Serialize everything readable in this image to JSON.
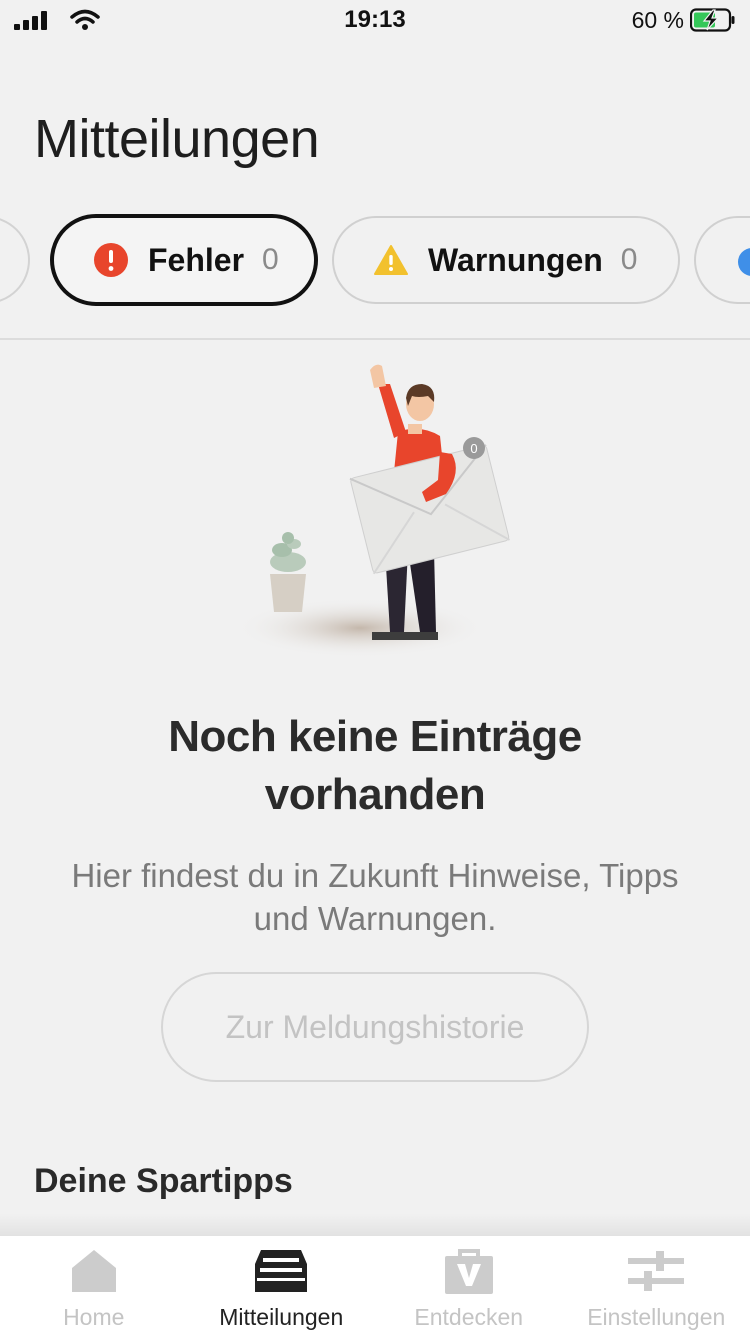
{
  "status_bar": {
    "time": "19:13",
    "battery_percent": "60 %"
  },
  "page": {
    "title": "Mitteilungen"
  },
  "filters": [
    {
      "label": "Fehler",
      "count": "0",
      "icon": "error-icon",
      "color": "#e8452c",
      "selected": true
    },
    {
      "label": "Warnungen",
      "count": "0",
      "icon": "warning-icon",
      "color": "#f2c12e",
      "selected": false
    },
    {
      "label": "",
      "count": "",
      "icon": "info-icon",
      "color": "#3f8fe8",
      "selected": false
    }
  ],
  "illustration": {
    "badge_count": "0"
  },
  "empty_state": {
    "title_line1": "Noch keine Einträge",
    "title_line2": "vorhanden",
    "text_line1": "Hier findest du in Zukunft Hinweise, Tipps",
    "text_line2": "und Warnungen.",
    "button_label": "Zur Meldungshistorie"
  },
  "sections": {
    "spartipps_title": "Deine Spartipps"
  },
  "tabbar": {
    "items": [
      {
        "label": "Home",
        "icon": "home-icon",
        "active": false
      },
      {
        "label": "Mitteilungen",
        "icon": "inbox-icon",
        "active": true
      },
      {
        "label": "Entdecken",
        "icon": "briefcase-icon",
        "active": false
      },
      {
        "label": "Einstellungen",
        "icon": "sliders-icon",
        "active": false
      }
    ]
  },
  "colors": {
    "accent_error": "#e8452c",
    "accent_warning": "#f2c12e",
    "accent_info": "#3f8fe8",
    "background": "#f1f1f1"
  }
}
